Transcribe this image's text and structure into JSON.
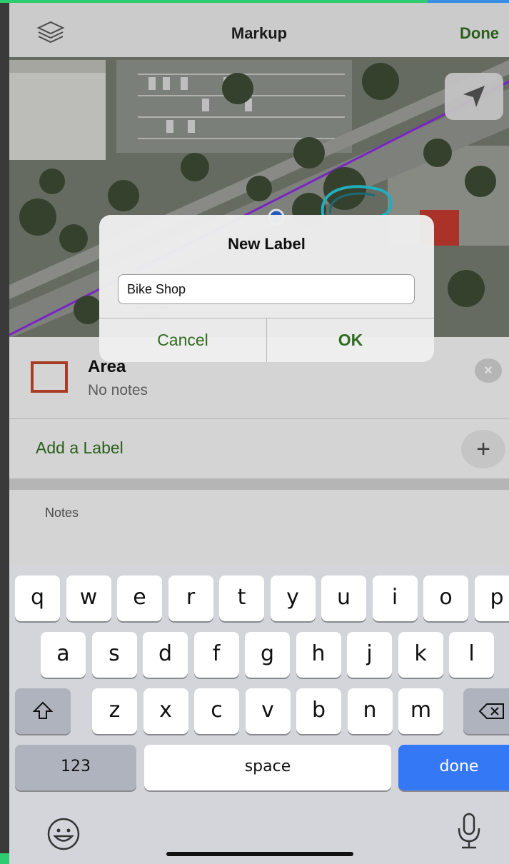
{
  "nav": {
    "title": "Markup",
    "done_label": "Done"
  },
  "dialog": {
    "title": "New Label",
    "input_value": "Bike Shop",
    "cancel_label": "Cancel",
    "ok_label": "OK"
  },
  "feature": {
    "title": "Area",
    "notes": "No notes",
    "add_label": "Add a Label",
    "notes_label": "Notes"
  },
  "keyboard": {
    "row1": [
      "q",
      "w",
      "e",
      "r",
      "t",
      "y",
      "u",
      "i",
      "o",
      "p"
    ],
    "row2": [
      "a",
      "s",
      "d",
      "f",
      "g",
      "h",
      "j",
      "k",
      "l"
    ],
    "row3": [
      "z",
      "x",
      "c",
      "v",
      "b",
      "n",
      "m"
    ],
    "numbers_label": "123",
    "space_label": "space",
    "done_label": "done"
  },
  "colors": {
    "accent_green": "#2f6b1f",
    "area_outline": "#c0452c",
    "keyboard_done": "#3478f6",
    "route_line": "#8a2be2",
    "trace_cyan": "#27c7d9"
  }
}
